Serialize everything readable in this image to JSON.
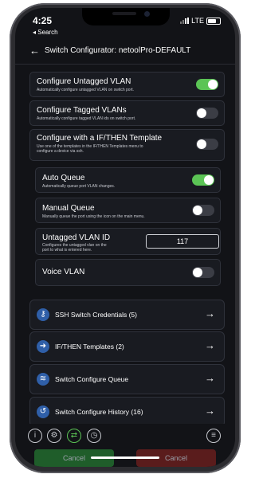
{
  "status": {
    "time": "4:25",
    "back_app": "◂ Search",
    "carrier": "LTE"
  },
  "nav": {
    "back_icon": "back-arrow-icon",
    "title": "Switch Configurator: netoolPro-DEFAULT"
  },
  "options": [
    {
      "title": "Configure Untagged VLAN",
      "subtitle": "Automatically configure untagged VLAN on switch port.",
      "on": true
    },
    {
      "title": "Configure Tagged VLANs",
      "subtitle": "Automatically configure tagged VLAN ids on switch port.",
      "on": false
    },
    {
      "title": "Configure with a IF/THEN Template",
      "subtitle": "Use one of the templates in the IF/THEN Templates menu to configure a device via ssh.",
      "on": false
    }
  ],
  "settings": {
    "auto_queue": {
      "title": "Auto Queue",
      "subtitle": "Automatically queue port VLAN changes.",
      "on": true
    },
    "manual_queue": {
      "title": "Manual Queue",
      "subtitle": "Manually queue the port using the icon on the main menu.",
      "on": false
    },
    "untagged_vlan": {
      "title": "Untagged VLAN ID",
      "subtitle": "Configures the untagged vlan on the port to what is entered here.",
      "value": "117"
    },
    "voice_vlan": {
      "title": "Voice VLAN",
      "on": false
    }
  },
  "nav_items": [
    {
      "label": "SSH Switch Credentials (5)",
      "icon": "key-icon"
    },
    {
      "label": "IF/THEN Templates (2)",
      "icon": "arrow-right-circle-icon"
    },
    {
      "label": "Switch Configure Queue",
      "icon": "layers-icon"
    },
    {
      "label": "Switch Configure History (16)",
      "icon": "history-icon"
    }
  ],
  "bottom_icons": [
    "info-icon",
    "settings-icon",
    "sync-icon",
    "clock-icon",
    "menu-icon"
  ],
  "actions": {
    "left": "Cancel",
    "right": "Cancel"
  },
  "colors": {
    "accent_green": "#5bc455",
    "card_bg": "#191b21",
    "screen_bg": "#121317",
    "icon_blue": "#2f5fa8"
  }
}
